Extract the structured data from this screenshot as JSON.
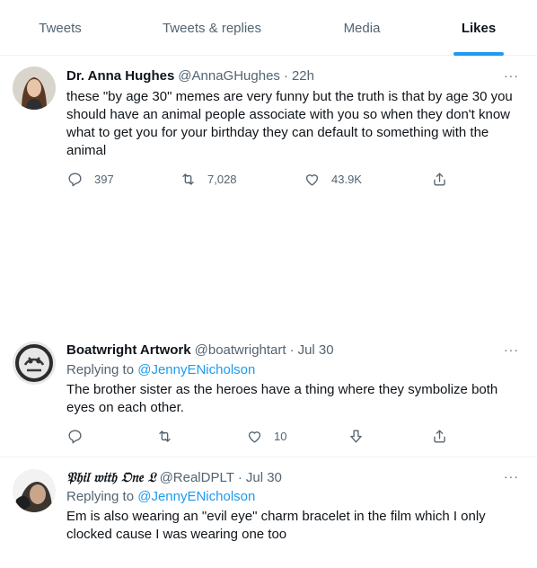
{
  "tabs": [
    {
      "label": "Tweets"
    },
    {
      "label": "Tweets & replies"
    },
    {
      "label": "Media"
    },
    {
      "label": "Likes"
    }
  ],
  "accent_color": "#1d9bf0",
  "more_label": "···",
  "tweets": [
    {
      "name": "Dr. Anna Hughes",
      "handle": "@AnnaGHughes",
      "time": "22h",
      "text": "these \"by age 30\" memes are very funny but the truth is that by age 30 you should have an animal people associate with you so when they don't know what to get you for your birthday they can default to something with the animal",
      "replies": "397",
      "retweets": "7,028",
      "likes": "43.9K"
    },
    {
      "name": "Boatwright Artwork",
      "handle": "@boatwrightart",
      "time": "Jul 30",
      "replying_label": "Replying to",
      "replying_to": "@JennyENicholson",
      "text": "The brother sister as the heroes have a thing where they symbolize both eyes on each other.",
      "likes": "10"
    },
    {
      "name": "𝔓𝔥𝔦𝔩 𝔴𝔦𝔱𝔥 𝔒𝔫𝔢 𝔏",
      "handle": "@RealDPLT",
      "time": "Jul 30",
      "replying_label": "Replying to",
      "replying_to": "@JennyENicholson",
      "text": "Em is also wearing an \"evil eye\" charm bracelet in the film which I only clocked cause I was wearing one too"
    }
  ]
}
